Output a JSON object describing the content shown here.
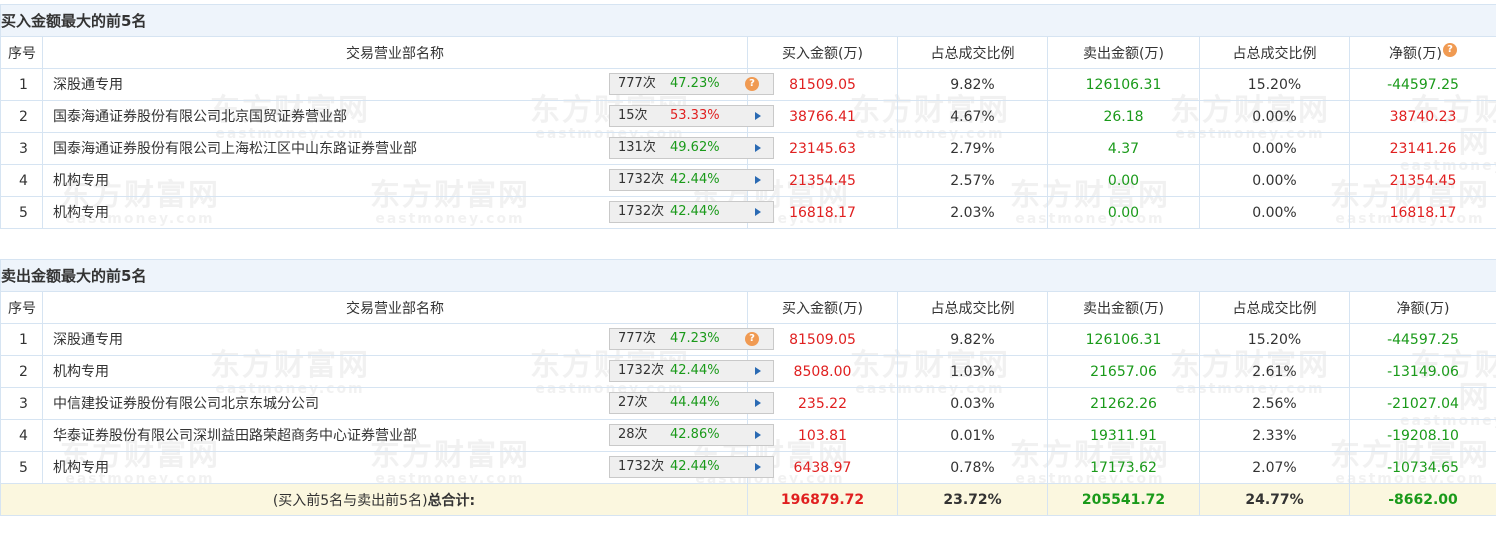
{
  "buy_section": {
    "title": "买入金额最大的前5名",
    "headers": [
      "序号",
      "交易营业部名称",
      "买入金额(万)",
      "占总成交比例",
      "卖出金额(万)",
      "占总成交比例",
      "净额(万)"
    ],
    "rows": [
      {
        "idx": "1",
        "name": "深股通专用",
        "count": "777次",
        "pct": "47.23%",
        "pct_color": "green",
        "badge_icon": "question-icon",
        "buy": "81509.05",
        "buy_ratio": "9.82%",
        "sell": "126106.31",
        "sell_ratio": "15.20%",
        "net": "-44597.25",
        "net_color": "green"
      },
      {
        "idx": "2",
        "name": "国泰海通证券股份有限公司北京国贸证券营业部",
        "count": "15次",
        "pct": "53.33%",
        "pct_color": "red",
        "badge_icon": "arrow-right-icon",
        "buy": "38766.41",
        "buy_ratio": "4.67%",
        "sell": "26.18",
        "sell_ratio": "0.00%",
        "net": "38740.23",
        "net_color": "red"
      },
      {
        "idx": "3",
        "name": "国泰海通证券股份有限公司上海松江区中山东路证券营业部",
        "count": "131次",
        "pct": "49.62%",
        "pct_color": "green",
        "badge_icon": "arrow-right-icon",
        "buy": "23145.63",
        "buy_ratio": "2.79%",
        "sell": "4.37",
        "sell_ratio": "0.00%",
        "net": "23141.26",
        "net_color": "red"
      },
      {
        "idx": "4",
        "name": "机构专用",
        "count": "1732次",
        "pct": "42.44%",
        "pct_color": "green",
        "badge_icon": "arrow-right-icon",
        "buy": "21354.45",
        "buy_ratio": "2.57%",
        "sell": "0.00",
        "sell_ratio": "0.00%",
        "net": "21354.45",
        "net_color": "red"
      },
      {
        "idx": "5",
        "name": "机构专用",
        "count": "1732次",
        "pct": "42.44%",
        "pct_color": "green",
        "badge_icon": "arrow-right-icon",
        "buy": "16818.17",
        "buy_ratio": "2.03%",
        "sell": "0.00",
        "sell_ratio": "0.00%",
        "net": "16818.17",
        "net_color": "red"
      }
    ]
  },
  "sell_section": {
    "title": "卖出金额最大的前5名",
    "headers": [
      "序号",
      "交易营业部名称",
      "买入金额(万)",
      "占总成交比例",
      "卖出金额(万)",
      "占总成交比例",
      "净额(万)"
    ],
    "rows": [
      {
        "idx": "1",
        "name": "深股通专用",
        "count": "777次",
        "pct": "47.23%",
        "pct_color": "green",
        "badge_icon": "question-icon",
        "buy": "81509.05",
        "buy_ratio": "9.82%",
        "sell": "126106.31",
        "sell_ratio": "15.20%",
        "net": "-44597.25",
        "net_color": "green"
      },
      {
        "idx": "2",
        "name": "机构专用",
        "count": "1732次",
        "pct": "42.44%",
        "pct_color": "green",
        "badge_icon": "arrow-right-icon",
        "buy": "8508.00",
        "buy_ratio": "1.03%",
        "sell": "21657.06",
        "sell_ratio": "2.61%",
        "net": "-13149.06",
        "net_color": "green"
      },
      {
        "idx": "3",
        "name": "中信建投证券股份有限公司北京东城分公司",
        "count": "27次",
        "pct": "44.44%",
        "pct_color": "green",
        "badge_icon": "arrow-right-icon",
        "buy": "235.22",
        "buy_ratio": "0.03%",
        "sell": "21262.26",
        "sell_ratio": "2.56%",
        "net": "-21027.04",
        "net_color": "green"
      },
      {
        "idx": "4",
        "name": "华泰证券股份有限公司深圳益田路荣超商务中心证券营业部",
        "count": "28次",
        "pct": "42.86%",
        "pct_color": "green",
        "badge_icon": "arrow-right-icon",
        "buy": "103.81",
        "buy_ratio": "0.01%",
        "sell": "19311.91",
        "sell_ratio": "2.33%",
        "net": "-19208.10",
        "net_color": "green"
      },
      {
        "idx": "5",
        "name": "机构专用",
        "count": "1732次",
        "pct": "42.44%",
        "pct_color": "green",
        "badge_icon": "arrow-right-icon",
        "buy": "6438.97",
        "buy_ratio": "0.78%",
        "sell": "17173.62",
        "sell_ratio": "2.07%",
        "net": "-10734.65",
        "net_color": "green"
      }
    ]
  },
  "total": {
    "label_prefix": "(买入前5名与卖出前5名)",
    "label_bold": "总合计:",
    "buy": "196879.72",
    "buy_ratio": "23.72%",
    "sell": "205541.72",
    "sell_ratio": "24.77%",
    "net": "-8662.00"
  },
  "watermark": {
    "cn": "东方财富网",
    "en": "eastmoney.com"
  },
  "colors": {
    "red": "#e02020",
    "green": "#1a9a1a",
    "header_bg": "#eef4fb",
    "total_bg": "#fbf7df",
    "border": "#d6e4f2",
    "badge_icon": "#f09a52",
    "arrow": "#2a6ab3"
  }
}
